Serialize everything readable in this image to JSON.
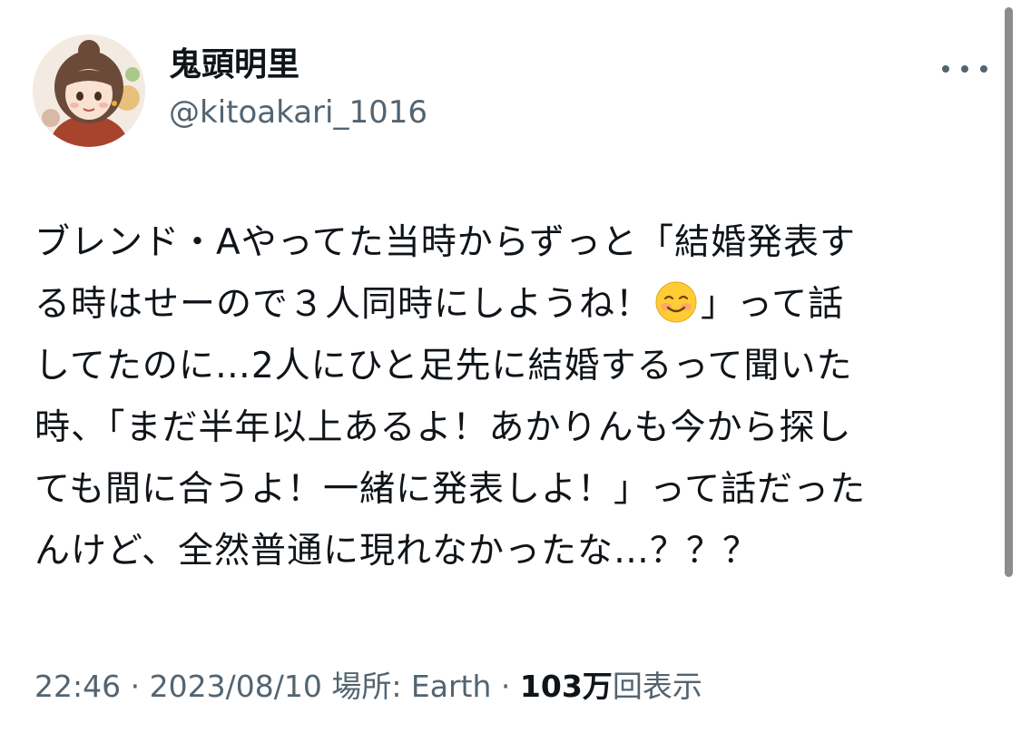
{
  "author": {
    "display_name": "鬼頭明里",
    "handle": "@kitoakari_1016"
  },
  "more_icon": "more-horizontal-icon",
  "tweet": {
    "lines": [
      "ブレンド・Aやってた当時からずっと「結婚発表す",
      "る時はせーので３人同時にしようね！",
      "」って話",
      "してたのに…2人にひと足先に結婚するって聞いた",
      "時、「まだ半年以上あるよ！あかりんも今から探し",
      "ても間に合うよ！一緒に発表しよ！」って話だった",
      "んけど、全然普通に現れなかったな…？？？"
    ],
    "emoji": "smiling-face-with-blush-icon"
  },
  "meta": {
    "time": "22:46",
    "separator": "·",
    "date": "2023/08/10",
    "location": "場所: Earth",
    "views_count": "103万",
    "views_label": "回表示"
  }
}
